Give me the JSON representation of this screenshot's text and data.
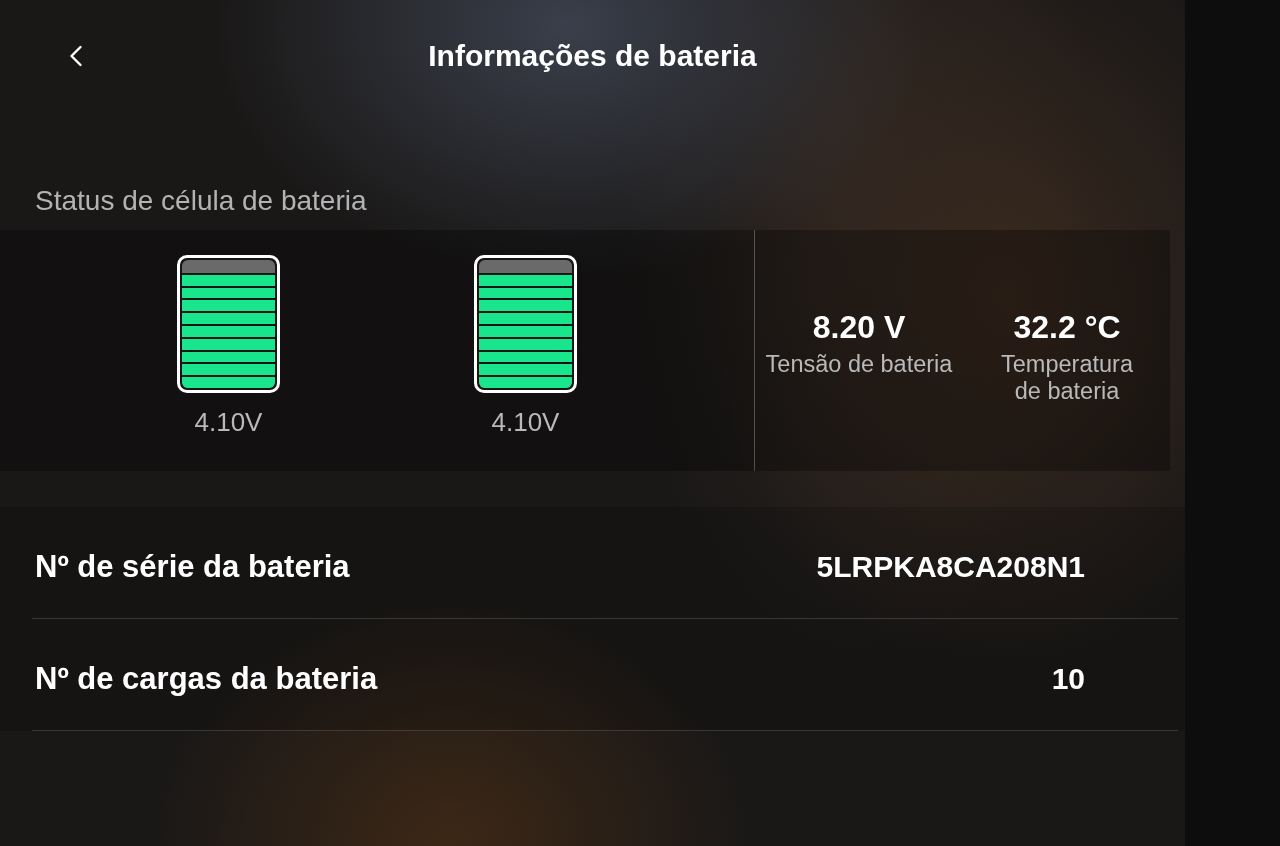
{
  "header": {
    "title": "Informações de bateria"
  },
  "cell_status": {
    "heading": "Status de célula de bateria",
    "cells": [
      {
        "level": 0.9,
        "voltage": "4.10V"
      },
      {
        "level": 0.9,
        "voltage": "4.10V"
      }
    ],
    "stats": [
      {
        "value": "8.20 V",
        "label": "Tensão de bateria"
      },
      {
        "value": "32.2 °C",
        "label": "Temperatura de bateria"
      }
    ]
  },
  "info_rows": [
    {
      "label": "Nº de série da bateria",
      "value": "5LRPKA8CA208N1"
    },
    {
      "label": "Nº de cargas da bateria",
      "value": "10"
    }
  ]
}
